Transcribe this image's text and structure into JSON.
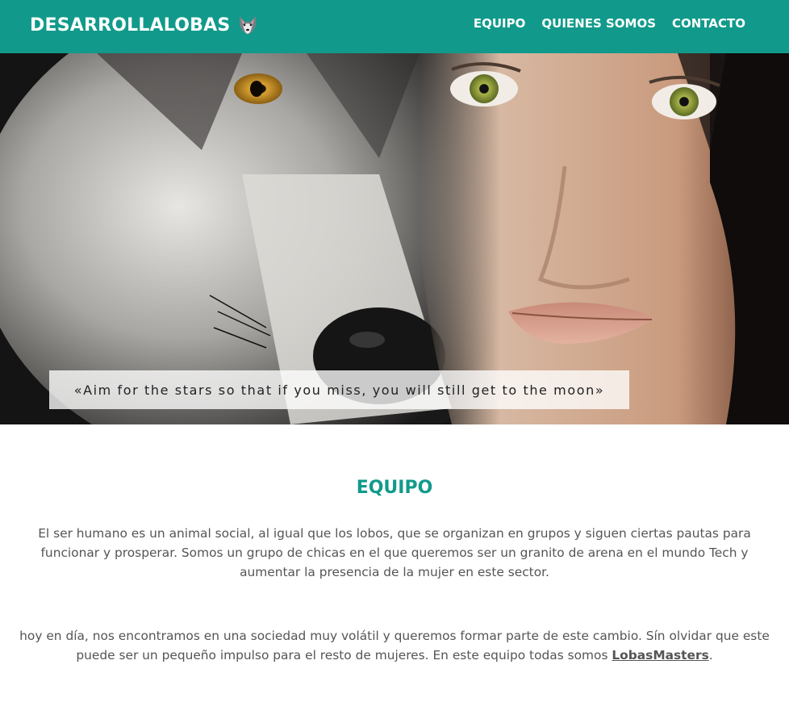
{
  "navbar": {
    "brand": "DESARROLLALOBAS",
    "brand_icon": "wolf-icon",
    "bg_color": "#119a8b",
    "links": [
      "EQUIPO",
      "QUIENES SOMOS",
      "CONTACTO"
    ]
  },
  "hero": {
    "quote": "«Aim for the stars so that if you miss, you will still get to the moon»"
  },
  "equipo": {
    "title": "EQUIPO",
    "paragraph1": "El ser humano es un animal social, al igual que los lobos, que se organizan en grupos y siguen ciertas pautas para funcionar y prosperar. Somos un grupo de chicas en el que queremos ser un granito de arena en el mundo Tech y aumentar la presencia de la mujer en este sector.",
    "paragraph2_text": "hoy en día, nos encontramos en una sociedad muy volátil y queremos formar parte de este cambio. Sín olvidar que este puede ser un pequeño impulso para el resto de mujeres. En este equipo todas somos ",
    "paragraph2_link": "LobasMasters",
    "paragraph2_end": "."
  }
}
